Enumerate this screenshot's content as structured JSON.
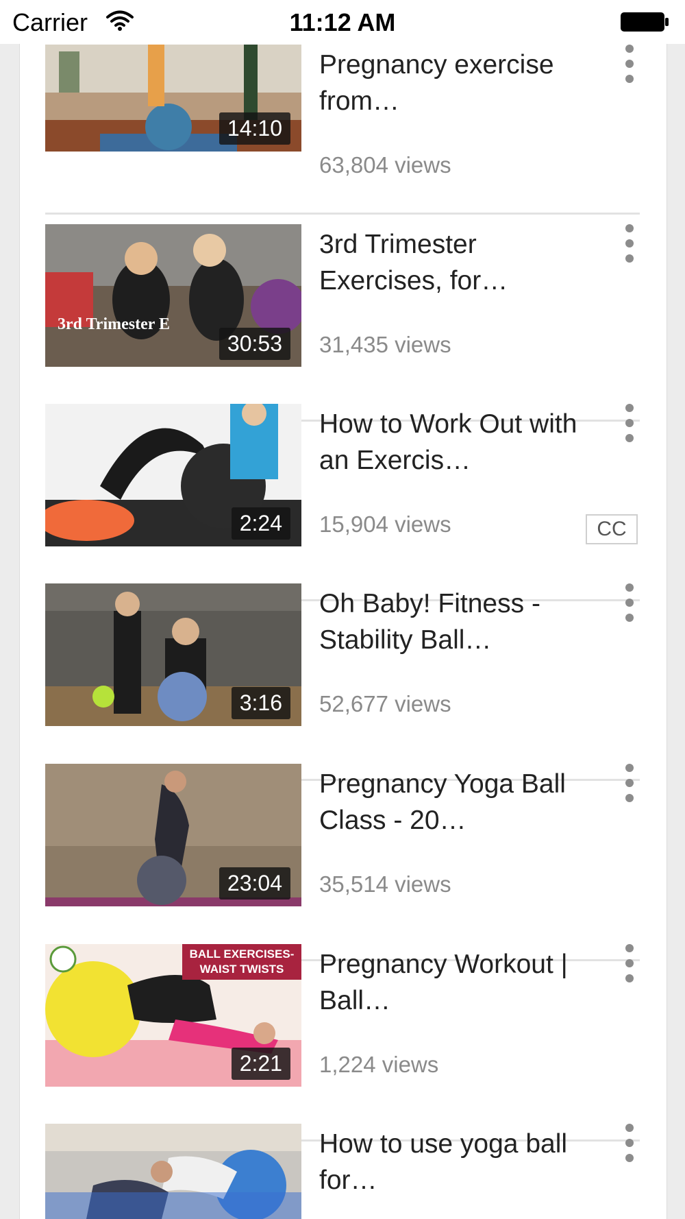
{
  "status_bar": {
    "carrier": "Carrier",
    "time": "11:12 AM",
    "wifi_icon": "wifi-icon",
    "battery_icon": "battery-icon"
  },
  "videos": [
    {
      "title": "Pregnancy exercise from…",
      "views": "63,804 views",
      "duration": "14:10",
      "cc": ""
    },
    {
      "title": "3rd Trimester Exercises, for…",
      "views": "31,435 views",
      "duration": "30:53",
      "cc": "",
      "thumb_caption": "3rd Trimester E"
    },
    {
      "title": "How to Work Out with an Exercis…",
      "views": "15,904 views",
      "duration": "2:24",
      "cc": "CC"
    },
    {
      "title": "Oh Baby! Fitness - Stability Ball…",
      "views": "52,677 views",
      "duration": "3:16",
      "cc": ""
    },
    {
      "title": "Pregnancy Yoga Ball Class - 20…",
      "views": "35,514 views",
      "duration": "23:04",
      "cc": ""
    },
    {
      "title": "Pregnancy Workout | Ball…",
      "views": "1,224 views",
      "duration": "2:21",
      "cc": "",
      "thumb_banner_1": "BALL EXERCISES-",
      "thumb_banner_2": "WAIST TWISTS"
    },
    {
      "title": "How to use yoga ball for…",
      "views": "",
      "duration": "",
      "cc": ""
    }
  ],
  "colors": {
    "background": "#ececec",
    "panel": "#ffffff",
    "divider": "#e2e2e2",
    "views_text": "#8a8a8a",
    "menu_dots": "#8c8c8c"
  }
}
